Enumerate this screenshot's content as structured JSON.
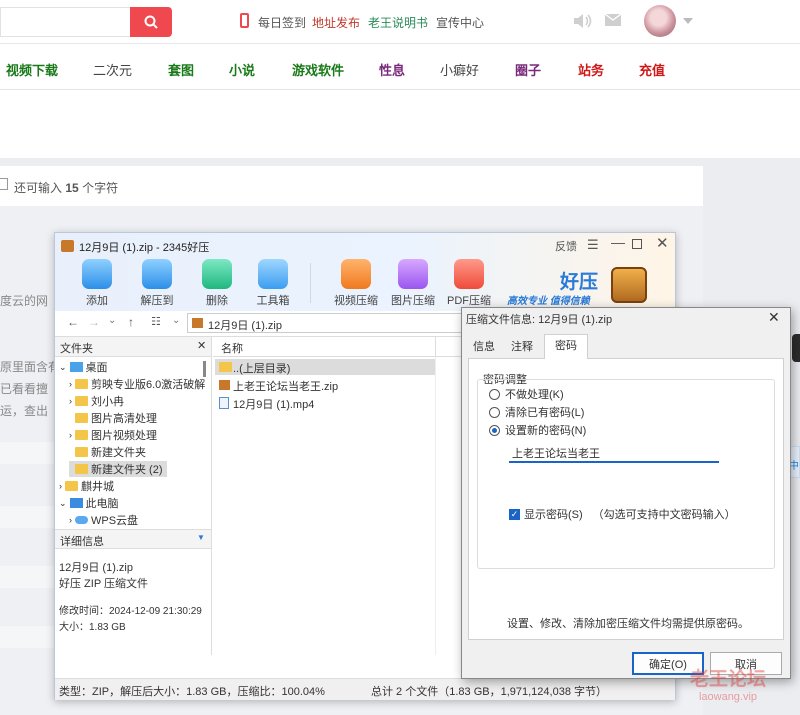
{
  "topbar": {
    "checkin": "每日签到",
    "address_publish": "地址发布",
    "manual": "老王说明书",
    "promo_center": "宣传中心"
  },
  "nav": {
    "items": [
      {
        "label": "视频下载",
        "color": "#1a7a1a"
      },
      {
        "label": "二次元",
        "color": "#444444"
      },
      {
        "label": "套图",
        "color": "#1a7a1a"
      },
      {
        "label": "小说",
        "color": "#1a7a1a"
      },
      {
        "label": "游戏软件",
        "color": "#1a7a1a"
      },
      {
        "label": "性息",
        "color": "#7a2a7a"
      },
      {
        "label": "小癖好",
        "color": "#444444"
      },
      {
        "label": "圈子",
        "color": "#7a2a7a"
      },
      {
        "label": "站务",
        "color": "#d01818"
      },
      {
        "label": "充值",
        "color": "#d01818"
      }
    ]
  },
  "charcount": {
    "prefix": "还可输入",
    "count": "15",
    "suffix": "个字符"
  },
  "bg_fragments": [
    "度云的网",
    "原里面含有",
    "已看看擅",
    "运，查出"
  ],
  "zipwin": {
    "title": "12月9日 (1).zip - 2345好压",
    "feedback": "反馈",
    "toolbar": [
      "添加",
      "解压到",
      "删除",
      "工具箱",
      "视频压缩",
      "图片压缩",
      "PDF压缩"
    ],
    "brand": "好压",
    "slogan": "高效专业 值得信赖",
    "address": "12月9日 (1).zip",
    "tree_header": "文件夹",
    "tree": [
      "桌面",
      "剪映专业版6.0激活破解",
      "刘小冉",
      "图片高清处理",
      "图片视频处理",
      "新建文件夹",
      "新建文件夹 (2)",
      "麒井城",
      "此电脑",
      "WPS云盘"
    ],
    "detail_header": "详细信息",
    "detail": {
      "name": "12月9日 (1).zip",
      "type": "好压 ZIP 压缩文件",
      "mtime": "修改时间：2024-12-09 21:30:29",
      "size": "大小：1.83 GB"
    },
    "list_header": "名称",
    "files": [
      "..(上层目录)",
      "上老王论坛当老王.zip",
      "12月9日 (1).mp4"
    ],
    "status_left": "类型：ZIP，解压后大小：1.83 GB，压缩比：100.04%",
    "status_right": "总计 2 个文件（1.83 GB，1,971,124,038 字节）"
  },
  "dialog": {
    "title": "压缩文件信息: 12月9日 (1).zip",
    "tabs": [
      "信息",
      "注释",
      "密码"
    ],
    "group": "密码调整",
    "options": [
      "不做处理(K)",
      "清除已有密码(L)",
      "设置新的密码(N)"
    ],
    "password": "上老王论坛当老王",
    "show_password": "显示密码(S)",
    "show_hint": "（勾选可支持中文密码输入）",
    "note": "设置、修改、清除加密压缩文件均需提供原密码。",
    "ok": "确定(O)",
    "cancel": "取消"
  },
  "upload": "上传中",
  "watermark": {
    "line1": "老王论坛",
    "line2": "laowang.vip"
  }
}
